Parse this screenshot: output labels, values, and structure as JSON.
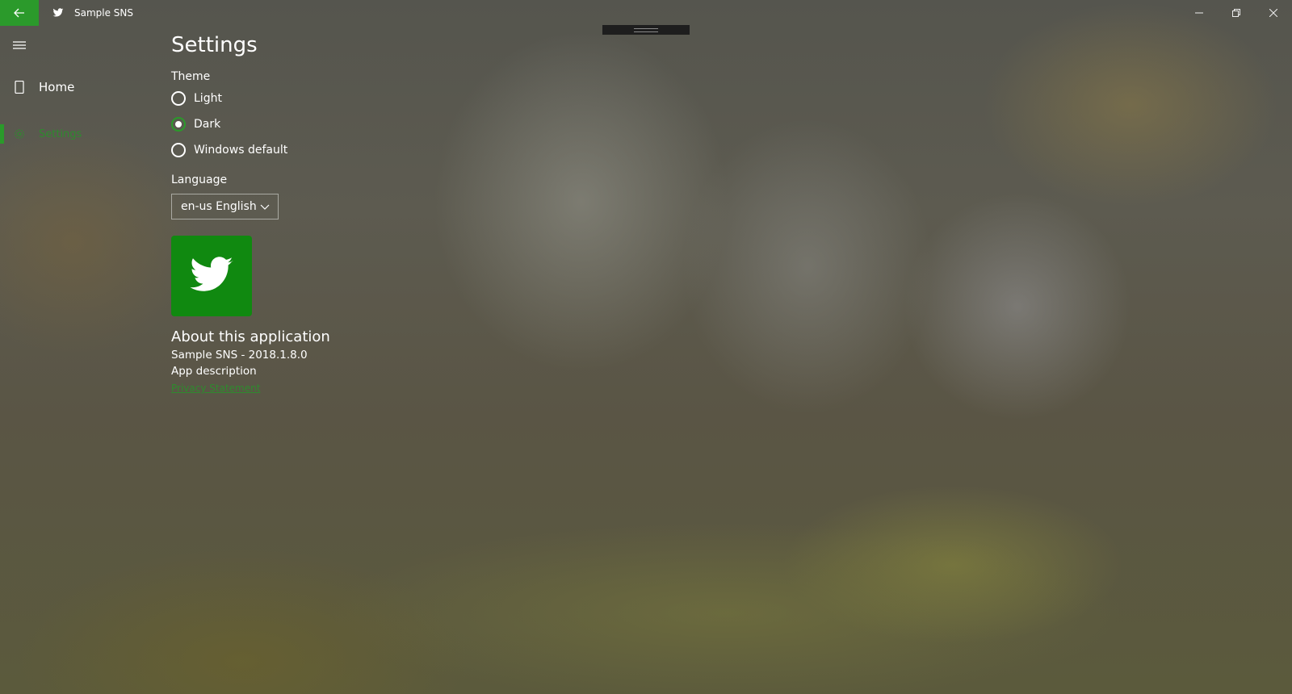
{
  "window": {
    "title": "Sample SNS",
    "back_icon": "arrow-left-icon",
    "app_icon": "bird-icon",
    "controls": [
      "minimize",
      "restore",
      "close"
    ]
  },
  "nav": {
    "items": [
      {
        "label": "Home",
        "icon": "tablet-icon",
        "selected": false
      },
      {
        "label": "Settings",
        "icon": "gear-icon",
        "selected": true
      }
    ]
  },
  "settings": {
    "title": "Settings",
    "theme": {
      "label": "Theme",
      "options": [
        {
          "label": "Light",
          "checked": false
        },
        {
          "label": "Dark",
          "checked": true
        },
        {
          "label": "Windows default",
          "checked": false
        }
      ]
    },
    "language": {
      "label": "Language",
      "selected": "en-us English"
    },
    "about": {
      "title": "About this application",
      "version": "Sample SNS - 2018.1.8.0",
      "description": "App description",
      "privacy_link": "Privacy Statement"
    }
  },
  "colors": {
    "accent": "#2b9a2b",
    "logo_bg": "#108910"
  }
}
